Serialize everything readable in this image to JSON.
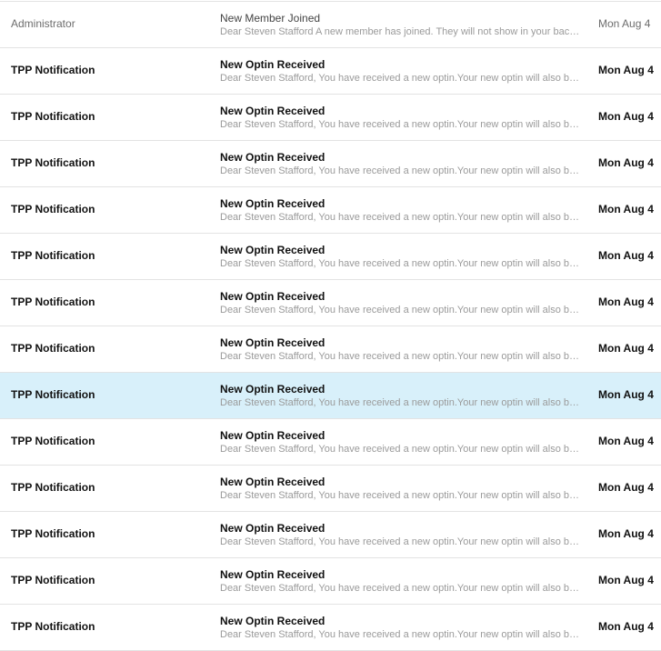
{
  "messages": [
    {
      "sender": "Administrator",
      "subject": "New Member Joined",
      "preview": "Dear Steven Stafford A new member has joined. They will not show in your back office",
      "date": "Mon Aug 4",
      "unread": false,
      "selected": false
    },
    {
      "sender": "TPP Notification",
      "subject": "New Optin Received",
      "preview": "Dear Steven Stafford, You have received a new optin.Your new optin will also be available",
      "date": "Mon Aug 4",
      "unread": true,
      "selected": false
    },
    {
      "sender": "TPP Notification",
      "subject": "New Optin Received",
      "preview": "Dear Steven Stafford, You have received a new optin.Your new optin will also be available",
      "date": "Mon Aug 4",
      "unread": true,
      "selected": false
    },
    {
      "sender": "TPP Notification",
      "subject": "New Optin Received",
      "preview": "Dear Steven Stafford, You have received a new optin.Your new optin will also be available",
      "date": "Mon Aug 4",
      "unread": true,
      "selected": false
    },
    {
      "sender": "TPP Notification",
      "subject": "New Optin Received",
      "preview": "Dear Steven Stafford, You have received a new optin.Your new optin will also be available",
      "date": "Mon Aug 4",
      "unread": true,
      "selected": false
    },
    {
      "sender": "TPP Notification",
      "subject": "New Optin Received",
      "preview": "Dear Steven Stafford, You have received a new optin.Your new optin will also be available",
      "date": "Mon Aug 4",
      "unread": true,
      "selected": false
    },
    {
      "sender": "TPP Notification",
      "subject": "New Optin Received",
      "preview": "Dear Steven Stafford, You have received a new optin.Your new optin will also be available",
      "date": "Mon Aug 4",
      "unread": true,
      "selected": false
    },
    {
      "sender": "TPP Notification",
      "subject": "New Optin Received",
      "preview": "Dear Steven Stafford, You have received a new optin.Your new optin will also be available",
      "date": "Mon Aug 4",
      "unread": true,
      "selected": false
    },
    {
      "sender": "TPP Notification",
      "subject": "New Optin Received",
      "preview": "Dear Steven Stafford, You have received a new optin.Your new optin will also be available",
      "date": "Mon Aug 4",
      "unread": true,
      "selected": true
    },
    {
      "sender": "TPP Notification",
      "subject": "New Optin Received",
      "preview": "Dear Steven Stafford, You have received a new optin.Your new optin will also be available",
      "date": "Mon Aug 4",
      "unread": true,
      "selected": false
    },
    {
      "sender": "TPP Notification",
      "subject": "New Optin Received",
      "preview": "Dear Steven Stafford, You have received a new optin.Your new optin will also be available",
      "date": "Mon Aug 4",
      "unread": true,
      "selected": false
    },
    {
      "sender": "TPP Notification",
      "subject": "New Optin Received",
      "preview": "Dear Steven Stafford, You have received a new optin.Your new optin will also be available",
      "date": "Mon Aug 4",
      "unread": true,
      "selected": false
    },
    {
      "sender": "TPP Notification",
      "subject": "New Optin Received",
      "preview": "Dear Steven Stafford, You have received a new optin.Your new optin will also be available",
      "date": "Mon Aug 4",
      "unread": true,
      "selected": false
    },
    {
      "sender": "TPP Notification",
      "subject": "New Optin Received",
      "preview": "Dear Steven Stafford, You have received a new optin.Your new optin will also be available",
      "date": "Mon Aug 4",
      "unread": true,
      "selected": false
    }
  ],
  "colors": {
    "selected_row": "#d8f0fa",
    "divider": "#e3e3e3",
    "preview_text": "#9a9a9a"
  }
}
